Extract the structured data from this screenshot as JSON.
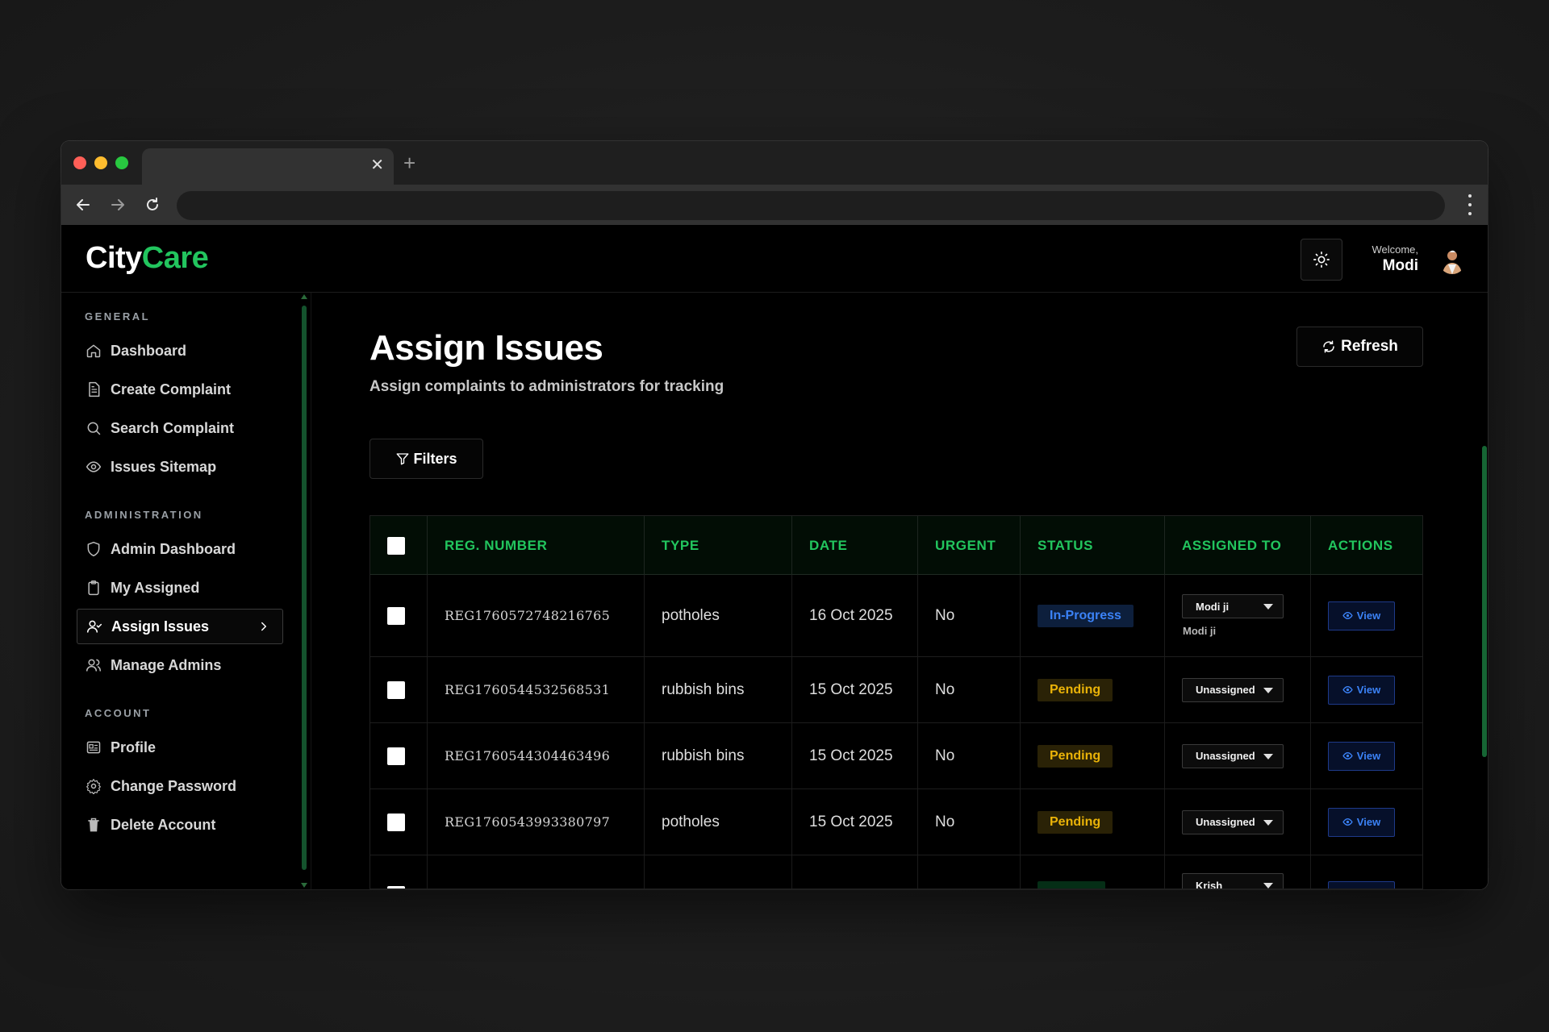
{
  "app": {
    "logo_part1": "City",
    "logo_part2": "Care",
    "accent_color": "#22c55e"
  },
  "header": {
    "welcome_label": "Welcome,",
    "user_name": "Modi",
    "theme_icon": "sun-icon"
  },
  "sidebar": {
    "sections": [
      {
        "title": "GENERAL",
        "items": [
          {
            "label": "Dashboard",
            "icon": "home-icon"
          },
          {
            "label": "Create Complaint",
            "icon": "document-icon"
          },
          {
            "label": "Search Complaint",
            "icon": "search-icon"
          },
          {
            "label": "Issues Sitemap",
            "icon": "eye-icon"
          }
        ]
      },
      {
        "title": "ADMINISTRATION",
        "items": [
          {
            "label": "Admin Dashboard",
            "icon": "shield-icon"
          },
          {
            "label": "My Assigned",
            "icon": "clipboard-icon"
          },
          {
            "label": "Assign Issues",
            "icon": "user-check-icon",
            "active": true
          },
          {
            "label": "Manage Admins",
            "icon": "users-icon"
          }
        ]
      },
      {
        "title": "ACCOUNT",
        "items": [
          {
            "label": "Profile",
            "icon": "id-card-icon"
          },
          {
            "label": "Change Password",
            "icon": "gear-icon"
          },
          {
            "label": "Delete Account",
            "icon": "trash-icon"
          }
        ]
      }
    ]
  },
  "main": {
    "title": "Assign Issues",
    "subtitle": "Assign complaints to administrators for tracking",
    "refresh_label": "Refresh",
    "filters_label": "Filters"
  },
  "table": {
    "columns": [
      "REG. NUMBER",
      "TYPE",
      "DATE",
      "URGENT",
      "STATUS",
      "ASSIGNED TO",
      "ACTIONS"
    ],
    "rows": [
      {
        "reg": "REG1760572748216765",
        "type": "potholes",
        "date": "16 Oct 2025",
        "urgent": "No",
        "status": "In-Progress",
        "status_kind": "inprogress",
        "assigned": "Modi ji",
        "assigned_note": "Modi ji",
        "action": "View"
      },
      {
        "reg": "REG1760544532568531",
        "type": "rubbish bins",
        "date": "15 Oct 2025",
        "urgent": "No",
        "status": "Pending",
        "status_kind": "pending",
        "assigned": "Unassigned",
        "assigned_note": "",
        "action": "View"
      },
      {
        "reg": "REG1760544304463496",
        "type": "rubbish bins",
        "date": "15 Oct 2025",
        "urgent": "No",
        "status": "Pending",
        "status_kind": "pending",
        "assigned": "Unassigned",
        "assigned_note": "",
        "action": "View"
      },
      {
        "reg": "REG1760543993380797",
        "type": "potholes",
        "date": "15 Oct 2025",
        "urgent": "No",
        "status": "Pending",
        "status_kind": "pending",
        "assigned": "Unassigned",
        "assigned_note": "",
        "action": "View"
      },
      {
        "reg": "",
        "type": "",
        "date": "",
        "urgent": "",
        "status": "",
        "status_kind": "resolved",
        "assigned": "Krish",
        "assigned_note": "",
        "action": ""
      }
    ]
  },
  "colors": {
    "in_progress": "#3b82f6",
    "pending": "#eab308",
    "header_green": "#22c55e"
  }
}
